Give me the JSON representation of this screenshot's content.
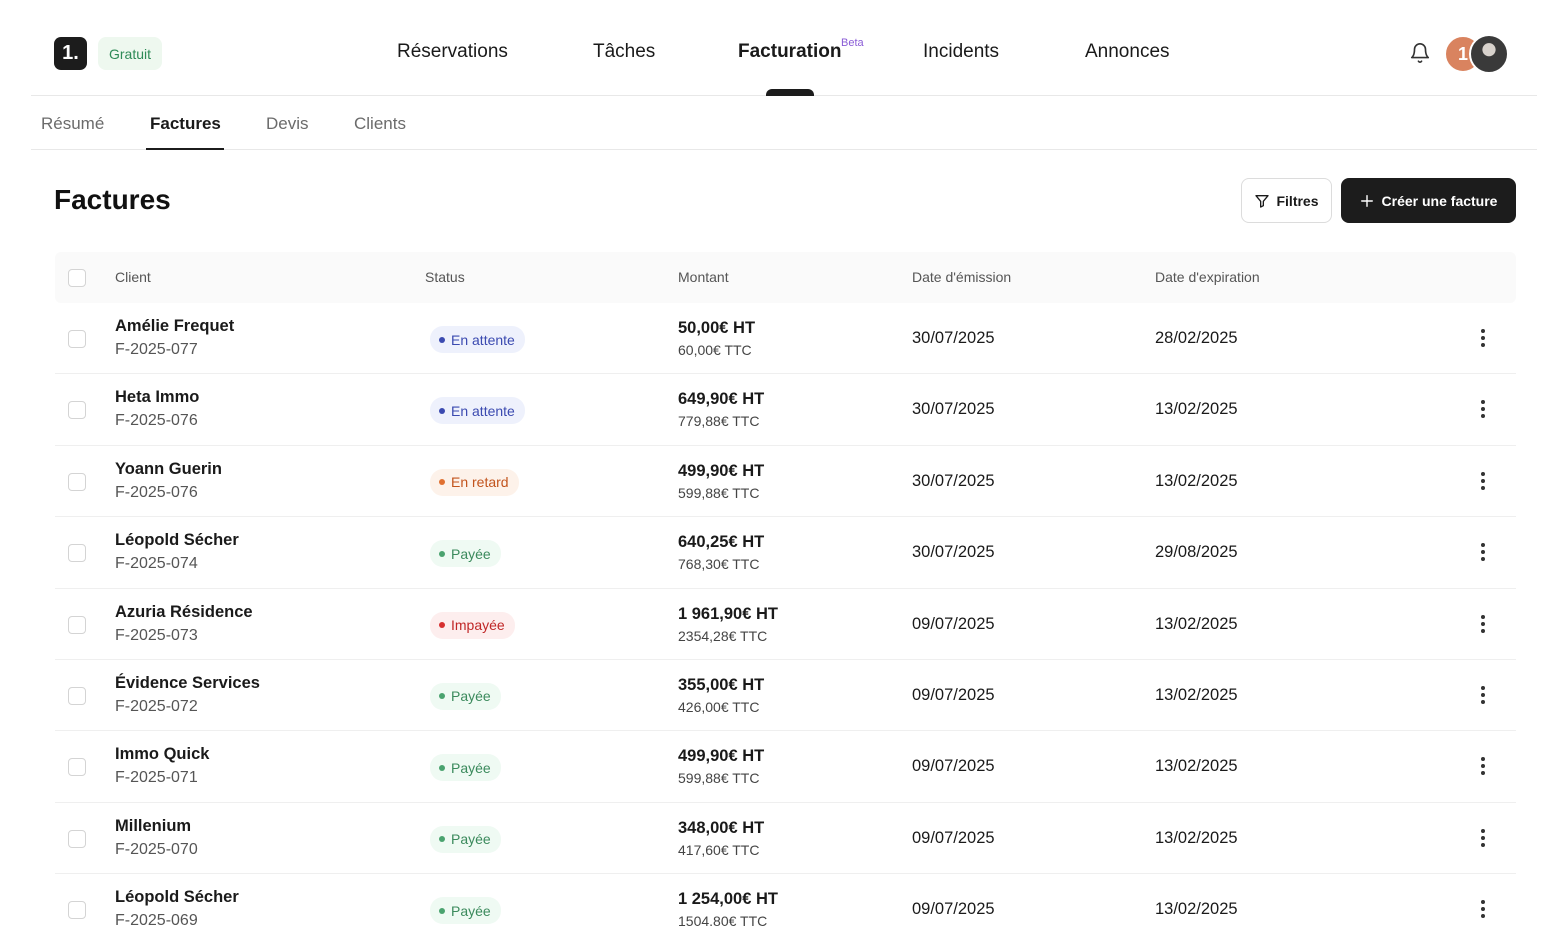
{
  "header": {
    "logo_text": "1.",
    "plan_badge": "Gratuit",
    "nav": [
      {
        "label": "Réservations"
      },
      {
        "label": "Tâches"
      },
      {
        "label": "Facturation",
        "badge": "Beta",
        "active": true
      },
      {
        "label": "Incidents"
      },
      {
        "label": "Annonces"
      }
    ],
    "avatar_initial": "1"
  },
  "subnav": [
    {
      "label": "Résumé"
    },
    {
      "label": "Factures",
      "active": true
    },
    {
      "label": "Devis"
    },
    {
      "label": "Clients"
    }
  ],
  "page": {
    "title": "Factures",
    "filter_label": "Filtres",
    "create_label": "Créer une facture"
  },
  "table": {
    "columns": [
      "Client",
      "Status",
      "Montant",
      "Date d'émission",
      "Date d'expiration"
    ],
    "rows": [
      {
        "client": "Amélie Frequet",
        "ref": "F-2025-077",
        "status": "En attente",
        "status_type": "pending",
        "ht": "50,00€ HT",
        "ttc": "60,00€ TTC",
        "emission": "30/07/2025",
        "expiration": "28/02/2025"
      },
      {
        "client": "Heta Immo",
        "ref": "F-2025-076",
        "status": "En attente",
        "status_type": "pending",
        "ht": "649,90€ HT",
        "ttc": "779,88€ TTC",
        "emission": "30/07/2025",
        "expiration": "13/02/2025"
      },
      {
        "client": "Yoann Guerin",
        "ref": "F-2025-076",
        "status": "En retard",
        "status_type": "late",
        "ht": "499,90€ HT",
        "ttc": "599,88€ TTC",
        "emission": "30/07/2025",
        "expiration": "13/02/2025"
      },
      {
        "client": "Léopold Sécher",
        "ref": "F-2025-074",
        "status": "Payée",
        "status_type": "paid",
        "ht": "640,25€ HT",
        "ttc": "768,30€ TTC",
        "emission": "30/07/2025",
        "expiration": "29/08/2025"
      },
      {
        "client": "Azuria Résidence",
        "ref": "F-2025-073",
        "status": "Impayée",
        "status_type": "unpaid",
        "ht": "1 961,90€ HT",
        "ttc": "2354,28€ TTC",
        "emission": "09/07/2025",
        "expiration": "13/02/2025"
      },
      {
        "client": "Évidence Services",
        "ref": "F-2025-072",
        "status": "Payée",
        "status_type": "paid",
        "ht": "355,00€ HT",
        "ttc": "426,00€ TTC",
        "emission": "09/07/2025",
        "expiration": "13/02/2025"
      },
      {
        "client": "Immo Quick",
        "ref": "F-2025-071",
        "status": "Payée",
        "status_type": "paid",
        "ht": "499,90€ HT",
        "ttc": "599,88€ TTC",
        "emission": "09/07/2025",
        "expiration": "13/02/2025"
      },
      {
        "client": "Millenium",
        "ref": "F-2025-070",
        "status": "Payée",
        "status_type": "paid",
        "ht": "348,00€ HT",
        "ttc": "417,60€ TTC",
        "emission": "09/07/2025",
        "expiration": "13/02/2025"
      },
      {
        "client": "Léopold Sécher",
        "ref": "F-2025-069",
        "status": "Payée",
        "status_type": "paid",
        "ht": "1 254,00€ HT",
        "ttc": "1504,80€ TTC",
        "emission": "09/07/2025",
        "expiration": "13/02/2025"
      }
    ]
  }
}
